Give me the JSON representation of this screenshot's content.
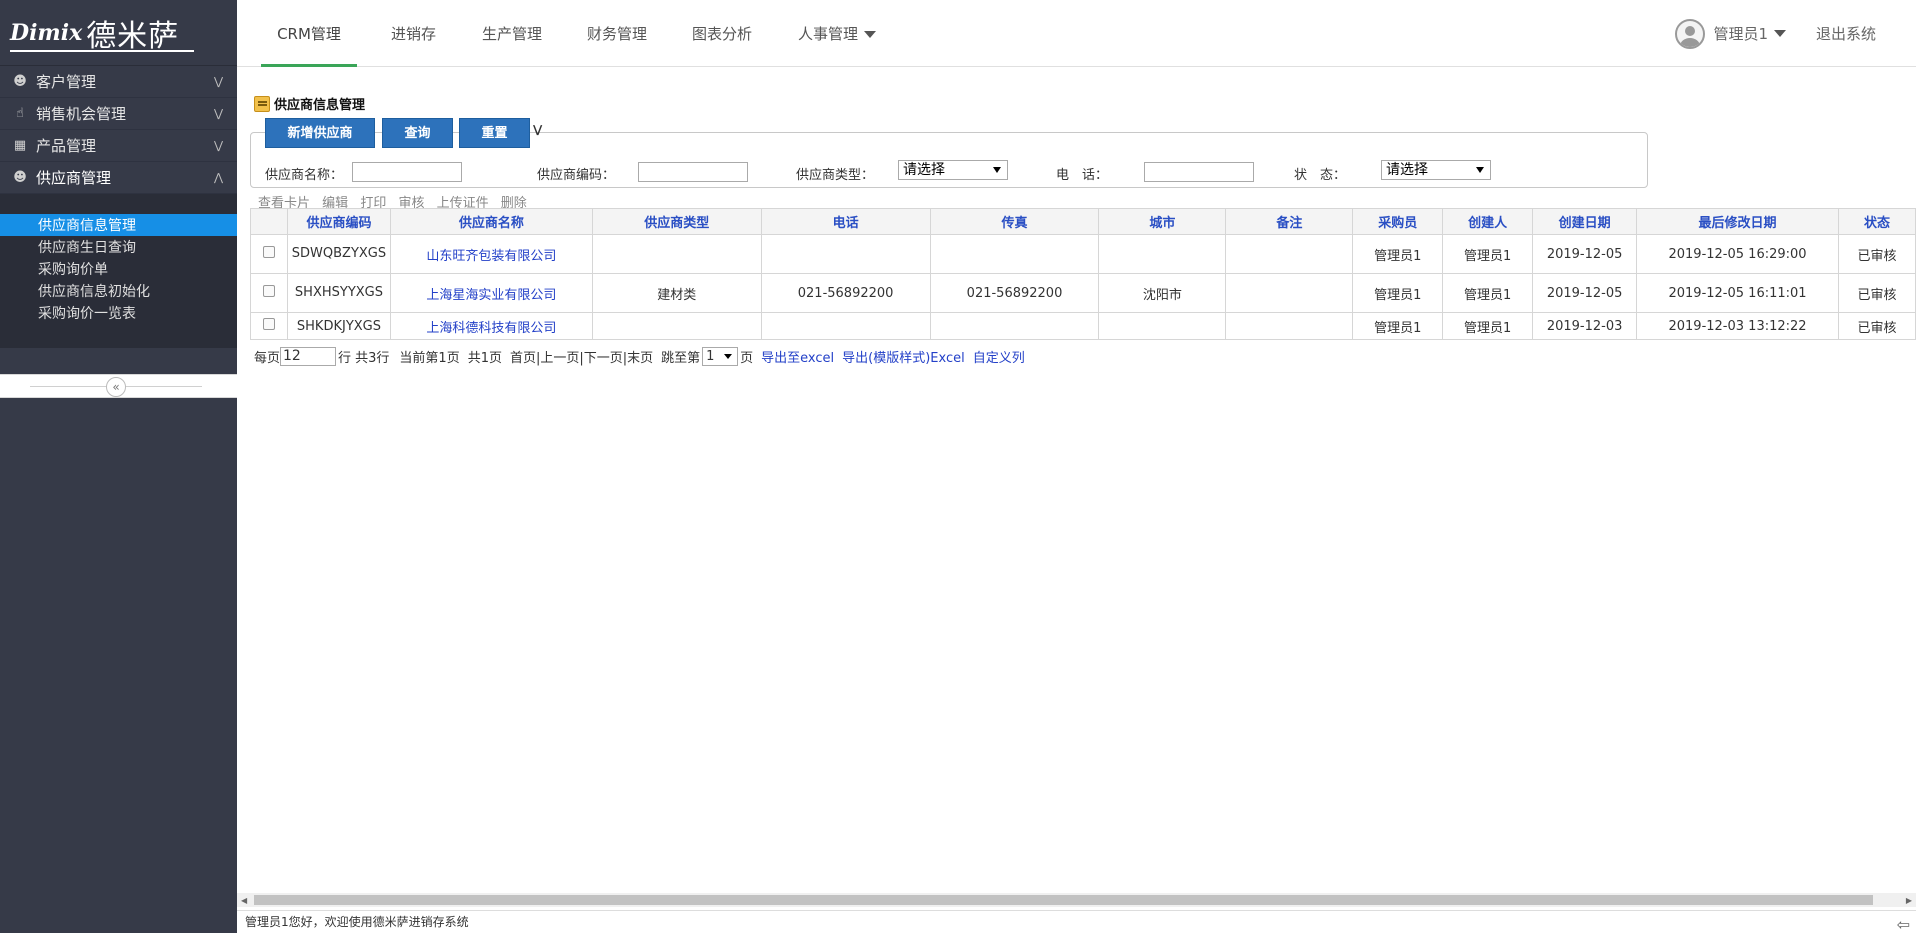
{
  "logo": {
    "brand": "Dimix",
    "cn": "德米萨"
  },
  "sidebar": {
    "groups": [
      {
        "label": "客户管理",
        "icon": "user-icon",
        "chev": "»"
      },
      {
        "label": "销售机会管理",
        "icon": "thumbs-up-icon",
        "chev": "»"
      },
      {
        "label": "产品管理",
        "icon": "grid-icon",
        "chev": "»"
      },
      {
        "label": "供应商管理",
        "icon": "user-icon",
        "chev": "«"
      }
    ],
    "subitems": [
      "供应商信息管理",
      "供应商生日查询",
      "采购询价单",
      "供应商信息初始化",
      "采购询价一览表"
    ]
  },
  "topnav": {
    "tabs": [
      "CRM管理",
      "进销存",
      "生产管理",
      "财务管理",
      "图表分析",
      "人事管理"
    ],
    "user": "管理员1",
    "logout": "退出系统"
  },
  "panel": {
    "title": "供应商信息管理",
    "buttons": {
      "add": "新增供应商",
      "query": "查询",
      "reset": "重置"
    },
    "filters": {
      "name_label": "供应商名称：",
      "code_label": "供应商编码：",
      "type_label": "供应商类型：",
      "type_value": "请选择",
      "phone_label": "电　话：",
      "status_label": "状　态：",
      "status_value": "请选择"
    },
    "actions": [
      "查看卡片",
      "编辑",
      "打印",
      "审核",
      "上传证件",
      "删除"
    ]
  },
  "grid": {
    "headers": [
      "供应商编码",
      "供应商名称",
      "供应商类型",
      "电话",
      "传真",
      "城市",
      "备注",
      "采购员",
      "创建人",
      "创建日期",
      "最后修改日期",
      "状态"
    ],
    "rows": [
      [
        "SDWQBZYXGS",
        "山东旺齐包装有限公司",
        "",
        "",
        "",
        "",
        "",
        "管理员1",
        "管理员1",
        "2019-12-05",
        "2019-12-05 16:29:00",
        "已审核"
      ],
      [
        "SHXHSYYXGS",
        "上海星海实业有限公司",
        "建材类",
        "021-56892200",
        "021-56892200",
        "沈阳市",
        "",
        "管理员1",
        "管理员1",
        "2019-12-05",
        "2019-12-05 16:11:01",
        "已审核"
      ],
      [
        "SHKDKJYXGS",
        "上海科德科技有限公司",
        "",
        "",
        "",
        "",
        "",
        "管理员1",
        "管理员1",
        "2019-12-03",
        "2019-12-03 13:12:22",
        "已审核"
      ]
    ]
  },
  "pager": {
    "per_page_label": "每页",
    "per_page_value": "12",
    "total_rows": "行 共3行",
    "current_page": "当前第1页",
    "total_pages": "共1页",
    "nav": "首页|上一页|下一页|末页",
    "jump_label": "跳至第",
    "jump_value": "1",
    "page_suffix": "页",
    "export_excel": "导出至excel",
    "export_template": "导出(模版样式)Excel",
    "custom_columns": "自定义列"
  },
  "status_bar": {
    "text": "管理员1您好，欢迎使用德米萨进销存系统"
  }
}
